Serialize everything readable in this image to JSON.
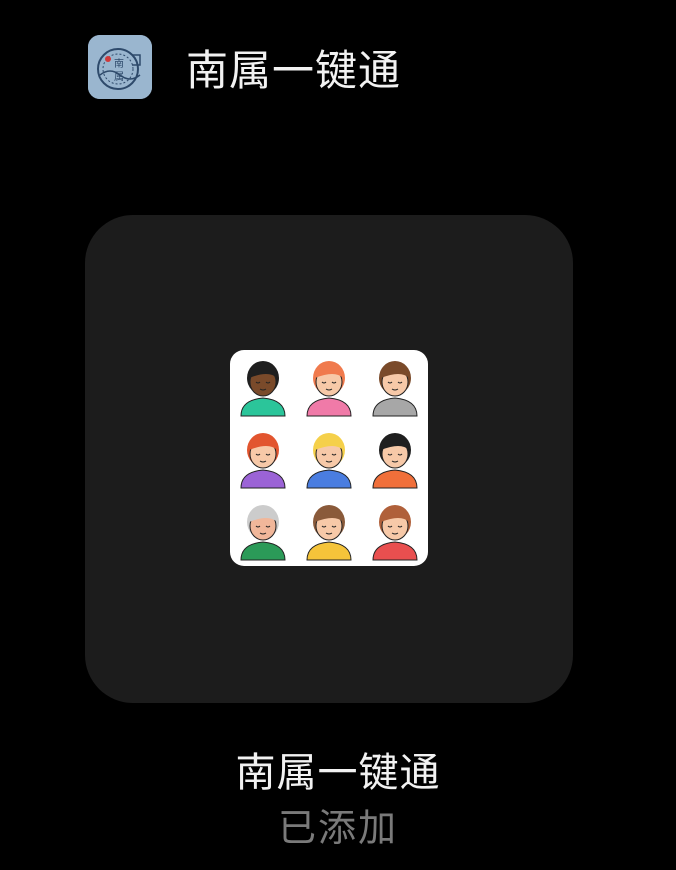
{
  "app": {
    "title": "南属一键通",
    "icon": "nanshu-app-icon",
    "icon_text": "南属"
  },
  "widget": {
    "image": "avatar-grid",
    "avatars": [
      {
        "skin": "#7a4a2a",
        "hair": "#1f1f1f",
        "shirt": "#2bc59a"
      },
      {
        "skin": "#f7c9a8",
        "hair": "#f07a4d",
        "shirt": "#f07aa8"
      },
      {
        "skin": "#f7c9a8",
        "hair": "#7a4a2a",
        "shirt": "#a7a7a7"
      },
      {
        "skin": "#f7c9a8",
        "hair": "#e2552f",
        "shirt": "#9b63d6"
      },
      {
        "skin": "#f7c9a8",
        "hair": "#f5d04a",
        "shirt": "#4a7de0"
      },
      {
        "skin": "#f7c9a8",
        "hair": "#1f1f1f",
        "shirt": "#f06f3a"
      },
      {
        "skin": "#f1b79a",
        "hair": "#cccccc",
        "shirt": "#2b9a58"
      },
      {
        "skin": "#f7c9a8",
        "hair": "#8a5a3a",
        "shirt": "#f5c43a"
      },
      {
        "skin": "#f7c9a8",
        "hair": "#b0603a",
        "shirt": "#e94f4f"
      }
    ]
  },
  "label": {
    "name": "南属一键通",
    "status": "已添加"
  }
}
